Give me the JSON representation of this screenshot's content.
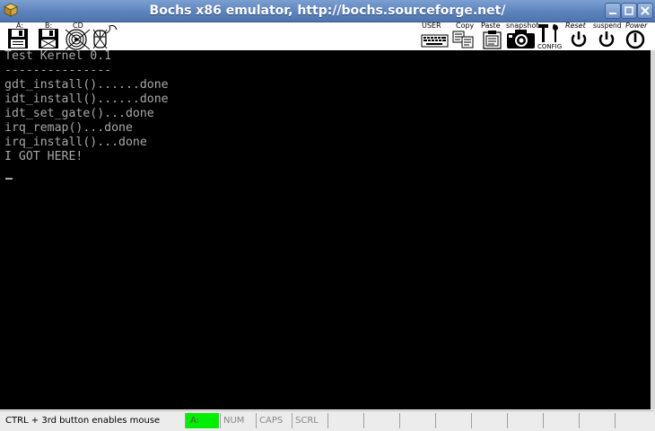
{
  "window": {
    "title": "Bochs x86 emulator, http://bochs.sourceforge.net/",
    "app_icon": "bochs-cube-icon",
    "buttons": [
      "minimize-icon",
      "maximize-icon",
      "close-icon"
    ]
  },
  "toolbar": {
    "floppy_a_label": "A:",
    "floppy_b_label": "B:",
    "cdrom_label": "CD",
    "user_label": "USER",
    "copy_label": "Copy",
    "paste_label": "Paste",
    "snapshot_label": "snapshot",
    "config_label": "CONFIG",
    "reset_label": "Reset",
    "suspend_label": "suspend",
    "power_label": "Power"
  },
  "console": {
    "lines": [
      "Test Kernel 0.1",
      "---------------",
      "gdt_install()......done",
      "idt_install()......done",
      "idt_set_gate()...done",
      "irq_remap()...done",
      "irq_install()...done",
      "I GOT HERE!"
    ]
  },
  "statusbar": {
    "message": "CTRL + 3rd button enables mouse",
    "drive": "A:",
    "num": "NUM",
    "caps": "CAPS",
    "scrl": "SCRL"
  },
  "colors": {
    "titlebar": "#5d83bd",
    "console_bg": "#000000",
    "console_text": "#a8a8a8",
    "drive_active": "#00ee00"
  }
}
